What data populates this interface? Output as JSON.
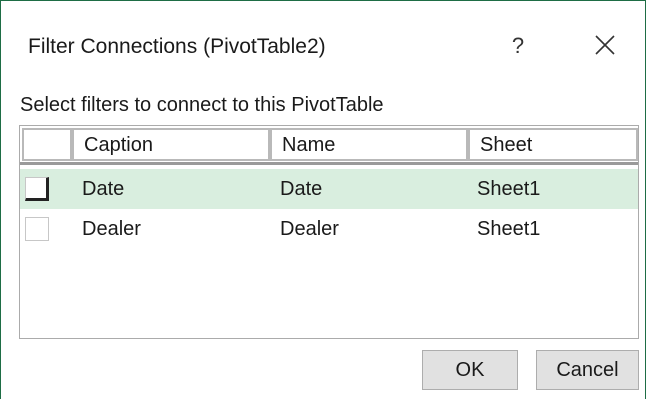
{
  "dialog": {
    "title": "Filter Connections (PivotTable2)",
    "help_label": "?",
    "instruction": "Select filters to connect to this PivotTable"
  },
  "columns": [
    "Caption",
    "Name",
    "Sheet"
  ],
  "rows": [
    {
      "caption": "Date",
      "name": "Date",
      "sheet": "Sheet1",
      "checked": false,
      "selected": true
    },
    {
      "caption": "Dealer",
      "name": "Dealer",
      "sheet": "Sheet1",
      "checked": false,
      "selected": false
    }
  ],
  "buttons": {
    "ok": "OK",
    "cancel": "Cancel"
  },
  "icons": {
    "help": "help-icon",
    "close": "close-icon",
    "checkbox": "checkbox-icon"
  },
  "colors": {
    "selection": "#d9eedf",
    "border_accent": "#1e6d45"
  }
}
